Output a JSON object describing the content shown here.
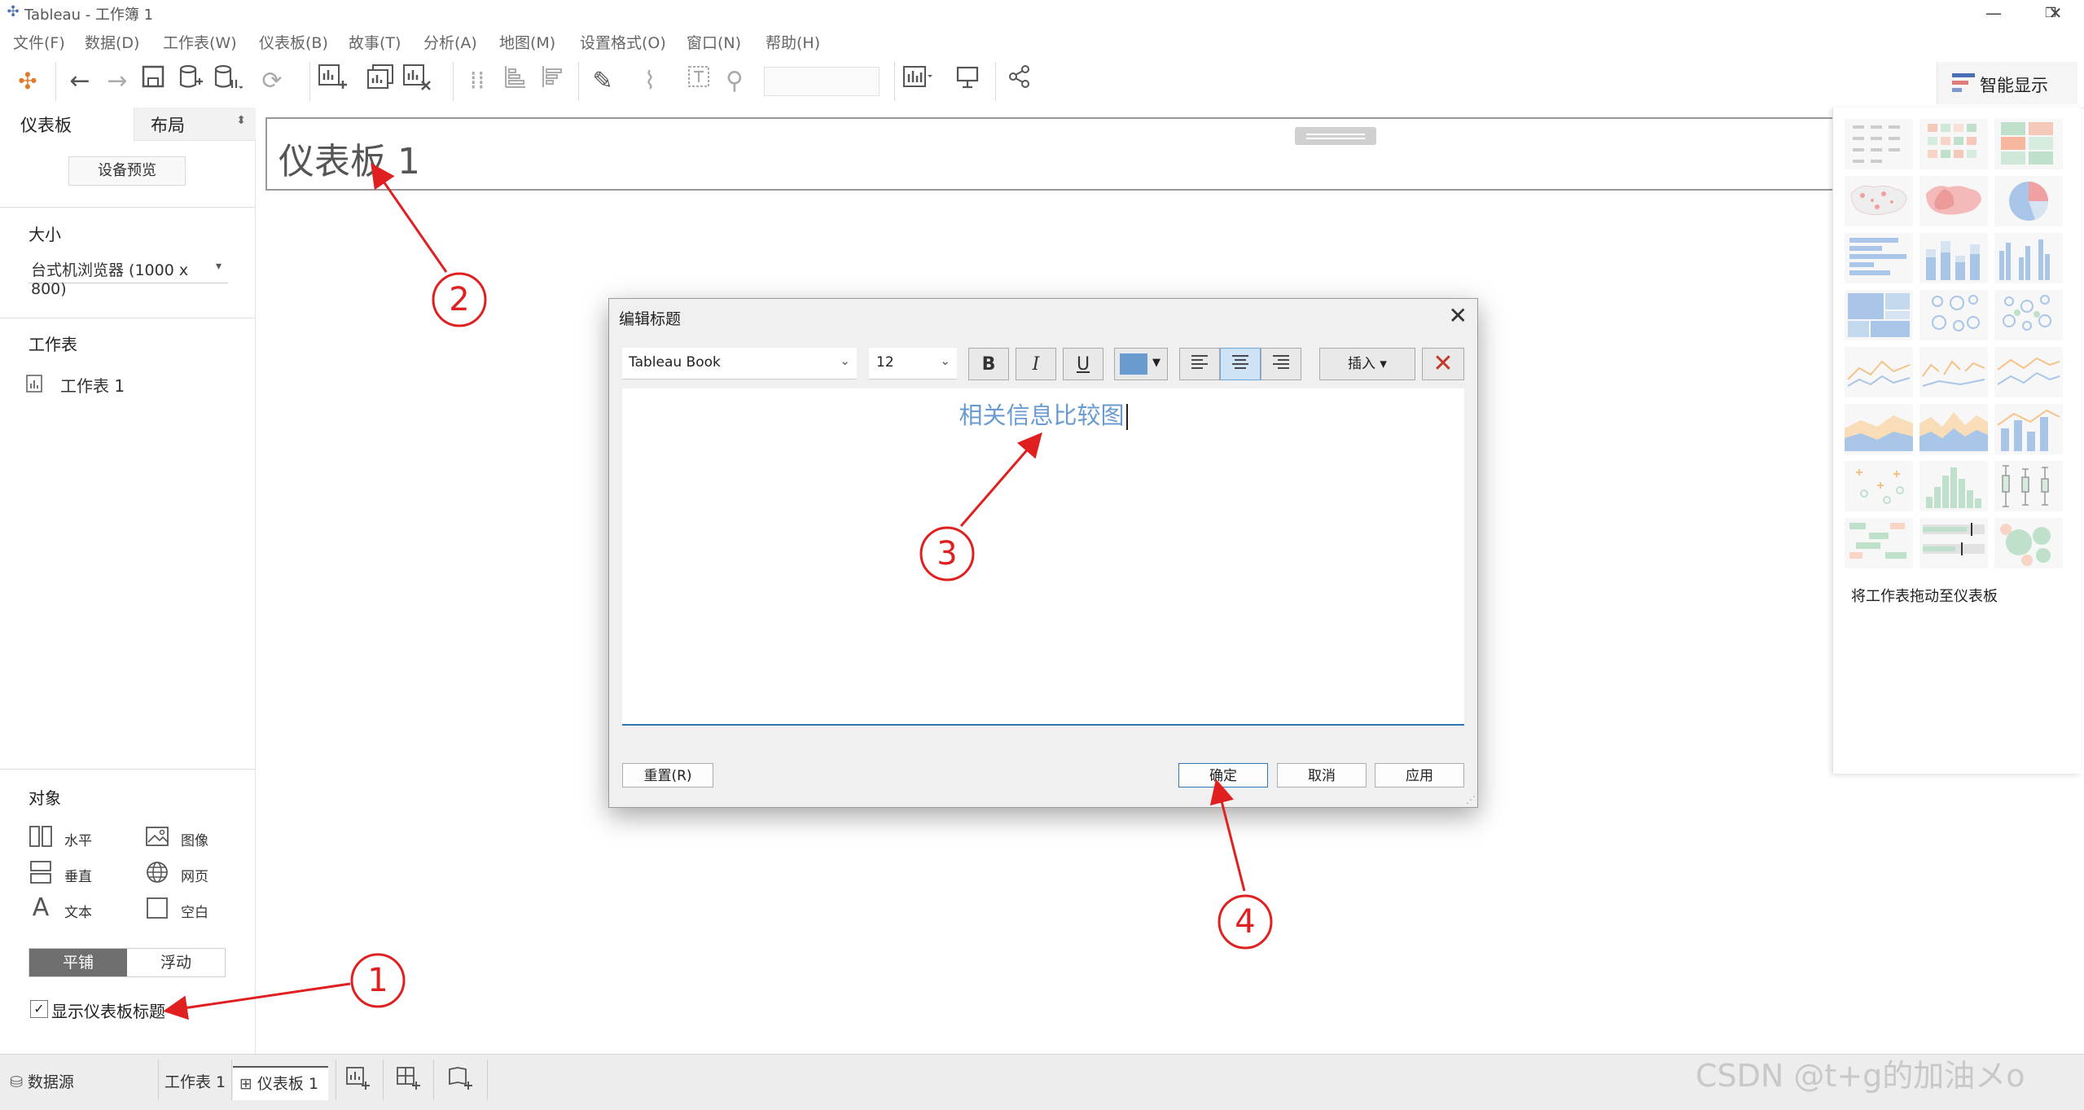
{
  "window": {
    "title": "Tableau - 工作簿 1",
    "controls": [
      "—",
      "❐",
      "✕"
    ]
  },
  "menu": [
    "文件(F)",
    "数据(D)",
    "工作表(W)",
    "仪表板(B)",
    "故事(T)",
    "分析(A)",
    "地图(M)",
    "设置格式(O)",
    "窗口(N)",
    "帮助(H)"
  ],
  "toolbar": {
    "smart_show_label": "智能显示"
  },
  "left_pane": {
    "tabs": [
      "仪表板",
      "布局"
    ],
    "device_preview": "设备预览",
    "size_title": "大小",
    "size_value": "台式机浏览器 (1000 x 800)",
    "sheets_title": "工作表",
    "sheet_items": [
      "工作表 1"
    ],
    "objects_title": "对象",
    "objects": [
      {
        "label": "水平",
        "icon": "horizontal-container-icon"
      },
      {
        "label": "图像",
        "icon": "image-icon"
      },
      {
        "label": "垂直",
        "icon": "vertical-container-icon"
      },
      {
        "label": "网页",
        "icon": "web-page-icon"
      },
      {
        "label": "文本",
        "icon": "text-icon"
      },
      {
        "label": "空白",
        "icon": "blank-icon"
      }
    ],
    "layout_modes": [
      "平铺",
      "浮动"
    ],
    "show_title_label": "显示仪表板标题",
    "show_title_checked": true
  },
  "canvas": {
    "dashboard_title": "仪表板 1"
  },
  "right_pane": {
    "hint": "将工作表拖动至仪表板"
  },
  "dialog": {
    "title": "编辑标题",
    "font": "Tableau Book",
    "font_size": "12",
    "bold": "B",
    "italic": "I",
    "underline": "U",
    "color": "#6a9bd0",
    "insert_label": "插入 ▾",
    "content_text": "相关信息比较图",
    "buttons": {
      "reset": "重置(R)",
      "ok": "确定",
      "cancel": "取消",
      "apply": "应用"
    }
  },
  "bottom_bar": {
    "data_source": "数据源",
    "tabs": [
      "工作表 1",
      "仪表板 1"
    ]
  },
  "annotations": [
    "1",
    "2",
    "3",
    "4"
  ],
  "watermark": "CSDN @t+g的加油メo"
}
